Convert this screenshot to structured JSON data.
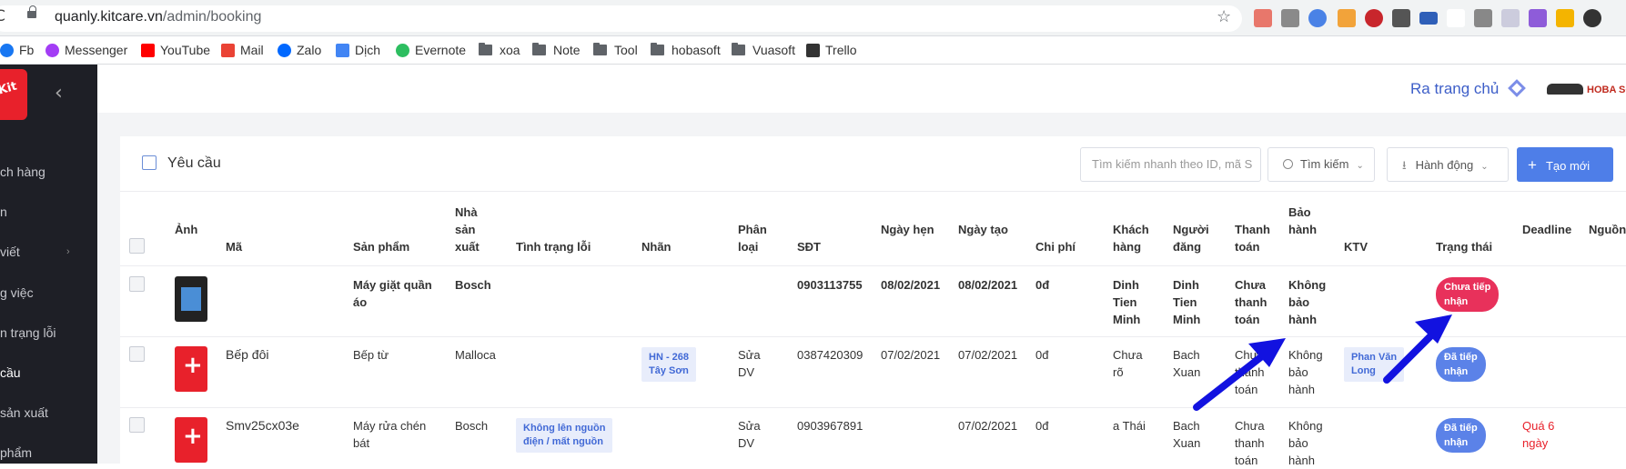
{
  "browser": {
    "url_host": "quanly.kitcare.vn",
    "url_path": "/admin/booking",
    "reload_glyph": "C",
    "star_glyph": "☆"
  },
  "bookmarks": [
    "Fb",
    "Messenger",
    "YouTube",
    "Mail",
    "Zalo",
    "Dịch",
    "Evernote",
    "xoa",
    "Note",
    "Tool",
    "hobasoft",
    "Vuasoft",
    "Trello"
  ],
  "sidebar": {
    "collapse_glyph": "‹",
    "items": [
      {
        "label": "ch hàng"
      },
      {
        "label": "n"
      },
      {
        "label": "viết"
      },
      {
        "label": "g việc"
      },
      {
        "label": "n trạng lỗi"
      },
      {
        "label": "cầu"
      },
      {
        "label": "sản xuất"
      },
      {
        "label": "phẩm"
      }
    ]
  },
  "topbar": {
    "home_link": "Ra trang chủ",
    "brand": "HOBA SO"
  },
  "card": {
    "title": "Yêu cầu",
    "search_placeholder": "Tìm kiếm nhanh theo ID, mã S",
    "search_button": "Tìm kiếm",
    "action_button": "Hành động",
    "create_button": "Tạo mới"
  },
  "table": {
    "headers": {
      "anh": "Ảnh",
      "ma": "Mã",
      "san_pham": "Sản phẩm",
      "nha_sx_1": "Nhà",
      "nha_sx_2": "sản",
      "nha_sx_3": "xuất",
      "tinh_trang": "Tình trạng lỗi",
      "nhan": "Nhãn",
      "phan_loai_1": "Phân",
      "phan_loai_2": "loại",
      "sdt": "SĐT",
      "ngay_hen": "Ngày hẹn",
      "ngay_tao": "Ngày tạo",
      "chi_phi": "Chi phí",
      "khach_1": "Khách",
      "khach_2": "hàng",
      "nguoi_dang_1": "Người",
      "nguoi_dang_2": "đăng",
      "thanh_toan_1": "Thanh",
      "thanh_toan_2": "toán",
      "bao_hanh_1": "Bảo",
      "bao_hanh_2": "hành",
      "ktv": "KTV",
      "trang_thai": "Trạng thái",
      "deadline": "Deadline",
      "nguon": "Nguồn"
    },
    "rows": [
      {
        "ma": "",
        "san_pham_1": "Máy giặt quần",
        "san_pham_2": "áo",
        "nha_sx": "Bosch",
        "tinh_trang_1": "",
        "tinh_trang_2": "",
        "nhan_1": "",
        "nhan_2": "",
        "phan_loai_1": "",
        "phan_loai_2": "",
        "sdt": "0903113755",
        "ngay_hen": "08/02/2021",
        "ngay_tao": "08/02/2021",
        "chi_phi": "0đ",
        "khach_1": "Dinh",
        "khach_2": "Tien",
        "khach_3": "Minh",
        "nguoi_dang_1": "Dinh",
        "nguoi_dang_2": "Tien",
        "nguoi_dang_3": "Minh",
        "thanh_toan_1": "Chưa",
        "thanh_toan_2": "thanh",
        "thanh_toan_3": "toán",
        "bao_hanh_1": "Không",
        "bao_hanh_2": "bảo",
        "bao_hanh_3": "hành",
        "ktv_1": "",
        "ktv_2": "",
        "trang_thai_1": "Chưa tiếp",
        "trang_thai_2": "nhận",
        "deadline_1": "",
        "deadline_2": ""
      },
      {
        "ma": "Bếp đôi",
        "san_pham_1": "Bếp từ",
        "san_pham_2": "",
        "nha_sx": "Malloca",
        "tinh_trang_1": "",
        "tinh_trang_2": "",
        "nhan_1": "HN - 268",
        "nhan_2": "Tây Sơn",
        "phan_loai_1": "Sửa",
        "phan_loai_2": "DV",
        "sdt": "0387420309",
        "ngay_hen": "07/02/2021",
        "ngay_tao": "07/02/2021",
        "chi_phi": "0đ",
        "khach_1": "Chưa",
        "khach_2": "rõ",
        "khach_3": "",
        "nguoi_dang_1": "Bach",
        "nguoi_dang_2": "Xuan",
        "nguoi_dang_3": "",
        "thanh_toan_1": "Chưa",
        "thanh_toan_2": "thanh",
        "thanh_toan_3": "toán",
        "bao_hanh_1": "Không",
        "bao_hanh_2": "bảo",
        "bao_hanh_3": "hành",
        "ktv_1": "Phan Văn",
        "ktv_2": "Long",
        "trang_thai_1": "Đã tiếp",
        "trang_thai_2": "nhận",
        "deadline_1": "",
        "deadline_2": ""
      },
      {
        "ma": "Smv25cx03e",
        "san_pham_1": "Máy rửa chén",
        "san_pham_2": "bát",
        "nha_sx": "Bosch",
        "tinh_trang_1": "Không lên nguồn",
        "tinh_trang_2": "điện / mất nguồn",
        "nhan_1": "",
        "nhan_2": "",
        "phan_loai_1": "Sửa",
        "phan_loai_2": "DV",
        "sdt": "0903967891",
        "ngay_hen": "",
        "ngay_tao": "07/02/2021",
        "chi_phi": "0đ",
        "khach_1": "a Thái",
        "khach_2": "",
        "khach_3": "",
        "nguoi_dang_1": "Bach",
        "nguoi_dang_2": "Xuan",
        "nguoi_dang_3": "",
        "thanh_toan_1": "Chưa",
        "thanh_toan_2": "thanh",
        "thanh_toan_3": "toán",
        "bao_hanh_1": "Không",
        "bao_hanh_2": "bảo",
        "bao_hanh_3": "hành",
        "ktv_1": "",
        "ktv_2": "",
        "trang_thai_1": "Đã tiếp",
        "trang_thai_2": "nhận",
        "deadline_1": "Quá 6",
        "deadline_2": "ngày"
      }
    ]
  },
  "colors": {
    "accent": "#4e7ee8",
    "sidebar": "#1e1f26",
    "status_new": "#e8315b",
    "status_received": "#5b82e8",
    "overdue": "#e8212b",
    "arrow": "#1212e0"
  }
}
